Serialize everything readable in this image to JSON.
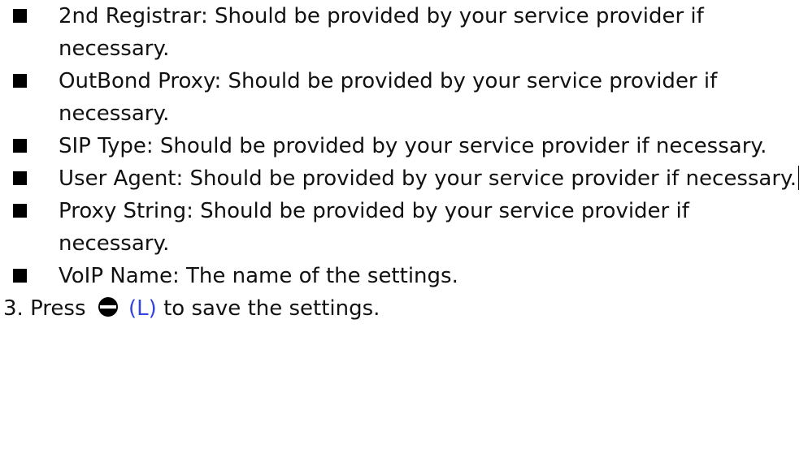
{
  "bullets": [
    {
      "text": "2nd Registrar: Should be provided by your service provider if necessary."
    },
    {
      "text": "OutBond Proxy: Should be provided by your service provider if necessary."
    },
    {
      "text": "SIP Type: Should be provided by your service provider if necessary."
    },
    {
      "text": "User Agent: Should be provided by your service provider if necessary."
    },
    {
      "text": "Proxy String: Should be provided by your service provider if necessary."
    },
    {
      "text": "VoIP Name: The name of the settings."
    }
  ],
  "step3": {
    "prefix": "3. Press",
    "icon": "left-softkey-icon",
    "key_label": "(L)",
    "suffix": "to save the settings."
  },
  "colors": {
    "text": "#111111",
    "key_label": "#3344dd",
    "bullet": "#000000"
  }
}
